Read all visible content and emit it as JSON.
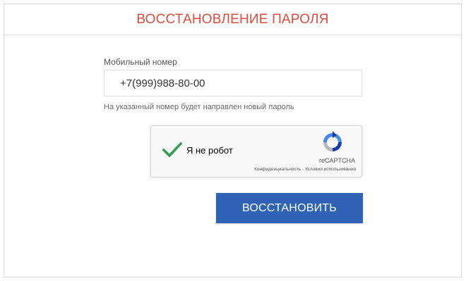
{
  "header": {
    "title": "ВОССТАНОВЛЕНИЕ ПАРОЛЯ"
  },
  "form": {
    "phone_label": "Мобильный номер",
    "phone_value": "+7(999)988-80-00",
    "hint": "На указанный номер будет направлен новый пароль",
    "submit_label": "ВОССТАНОВИТЬ"
  },
  "captcha": {
    "label": "Я не робот",
    "checked": true,
    "brand": "reCAPTCHA",
    "privacy_link": "Конфиденциальность",
    "separator": " - ",
    "terms_link": "Условия использования",
    "check_color": "#2e9f4f"
  },
  "colors": {
    "title": "#e04b3a",
    "button": "#2f63b6"
  }
}
